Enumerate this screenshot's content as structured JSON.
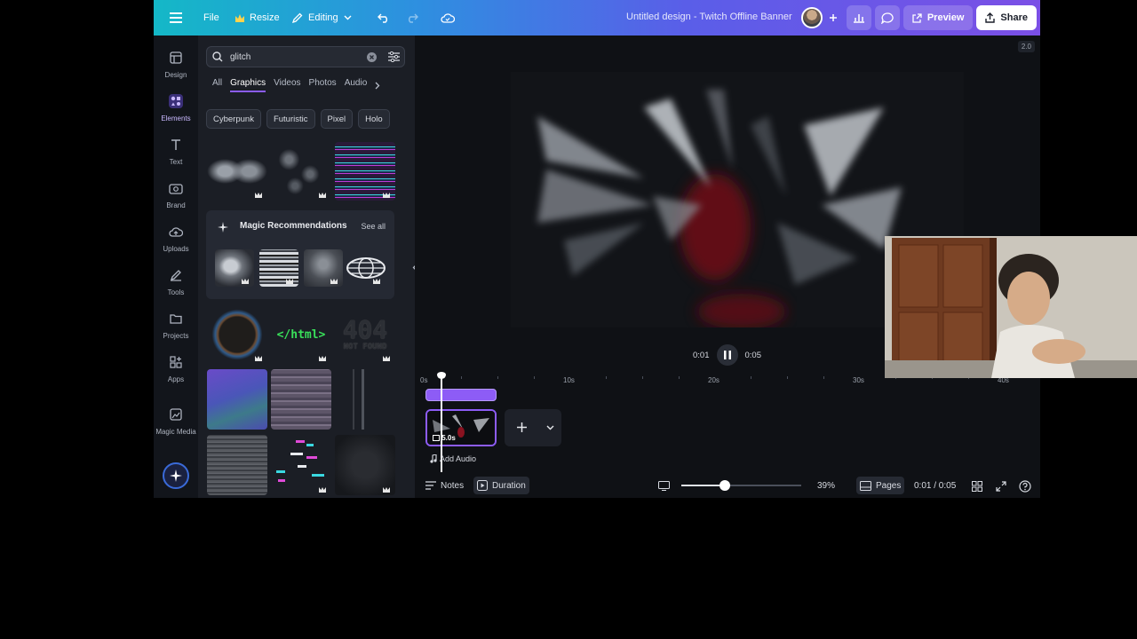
{
  "topbar": {
    "file_label": "File",
    "resize_label": "Resize",
    "mode_label": "Editing",
    "title": "Untitled design - Twitch Offline Banner",
    "preview_label": "Preview",
    "share_label": "Share"
  },
  "rail": {
    "items": [
      {
        "label": "Design",
        "icon": "design-icon"
      },
      {
        "label": "Elements",
        "icon": "elements-icon"
      },
      {
        "label": "Text",
        "icon": "text-icon"
      },
      {
        "label": "Brand",
        "icon": "brand-icon"
      },
      {
        "label": "Uploads",
        "icon": "uploads-icon"
      },
      {
        "label": "Tools",
        "icon": "tools-icon"
      },
      {
        "label": "Projects",
        "icon": "projects-icon"
      },
      {
        "label": "Apps",
        "icon": "apps-icon"
      },
      {
        "label": "Magic Media",
        "icon": "magic-media-icon"
      }
    ]
  },
  "panel": {
    "search_value": "glitch",
    "tabs": [
      "All",
      "Graphics",
      "Videos",
      "Photos",
      "Audio"
    ],
    "active_tab": "Graphics",
    "chips": [
      "Cyberpunk",
      "Futuristic",
      "Pixel",
      "Holo"
    ],
    "magic": {
      "title": "Magic Recommendations",
      "see_all": "See all"
    },
    "html_text": "</html>",
    "not_found_big": "404",
    "not_found_small": "NOT FOUND"
  },
  "canvas": {
    "zoom_tag": "2.0",
    "current_time": "0:01",
    "total_time": "0:05"
  },
  "timeline": {
    "ticks": [
      "0s",
      "10s",
      "20s",
      "30s",
      "40s"
    ],
    "clip_duration": "5.0s",
    "add_audio_label": "Add Audio"
  },
  "footer": {
    "notes_label": "Notes",
    "duration_label": "Duration",
    "zoom_percent": "39%",
    "zoom_fraction": 0.36,
    "pages_label": "Pages",
    "time_readout": "0:01 / 0:05"
  },
  "colors": {
    "accent": "#8d5cf6",
    "topbar_start": "#14b8c7",
    "topbar_end": "#7b4fe6"
  }
}
